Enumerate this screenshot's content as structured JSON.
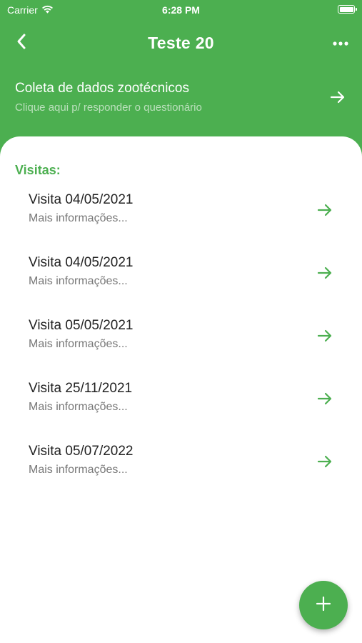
{
  "status_bar": {
    "carrier": "Carrier",
    "time": "6:28 PM"
  },
  "header": {
    "title": "Teste 20",
    "back_icon": "chevron-left-icon",
    "more_icon": "more-horizontal-icon"
  },
  "survey": {
    "title": "Coleta de dados zootécnicos",
    "subtitle": "Clique aqui p/ responder o questionário",
    "icon": "arrow-right-icon"
  },
  "visits": {
    "section_title": "Visitas:",
    "items": [
      {
        "label": "Visita 04/05/2021",
        "subtitle": "Mais informações..."
      },
      {
        "label": "Visita 04/05/2021",
        "subtitle": "Mais informações..."
      },
      {
        "label": "Visita 05/05/2021",
        "subtitle": "Mais informações..."
      },
      {
        "label": "Visita 25/11/2021",
        "subtitle": "Mais informações..."
      },
      {
        "label": "Visita 05/07/2022",
        "subtitle": "Mais informações..."
      }
    ]
  },
  "fab": {
    "icon": "plus-icon"
  },
  "colors": {
    "primary": "#4caf50",
    "background": "#ffffff",
    "text_primary": "#222222",
    "text_secondary": "#777777"
  }
}
